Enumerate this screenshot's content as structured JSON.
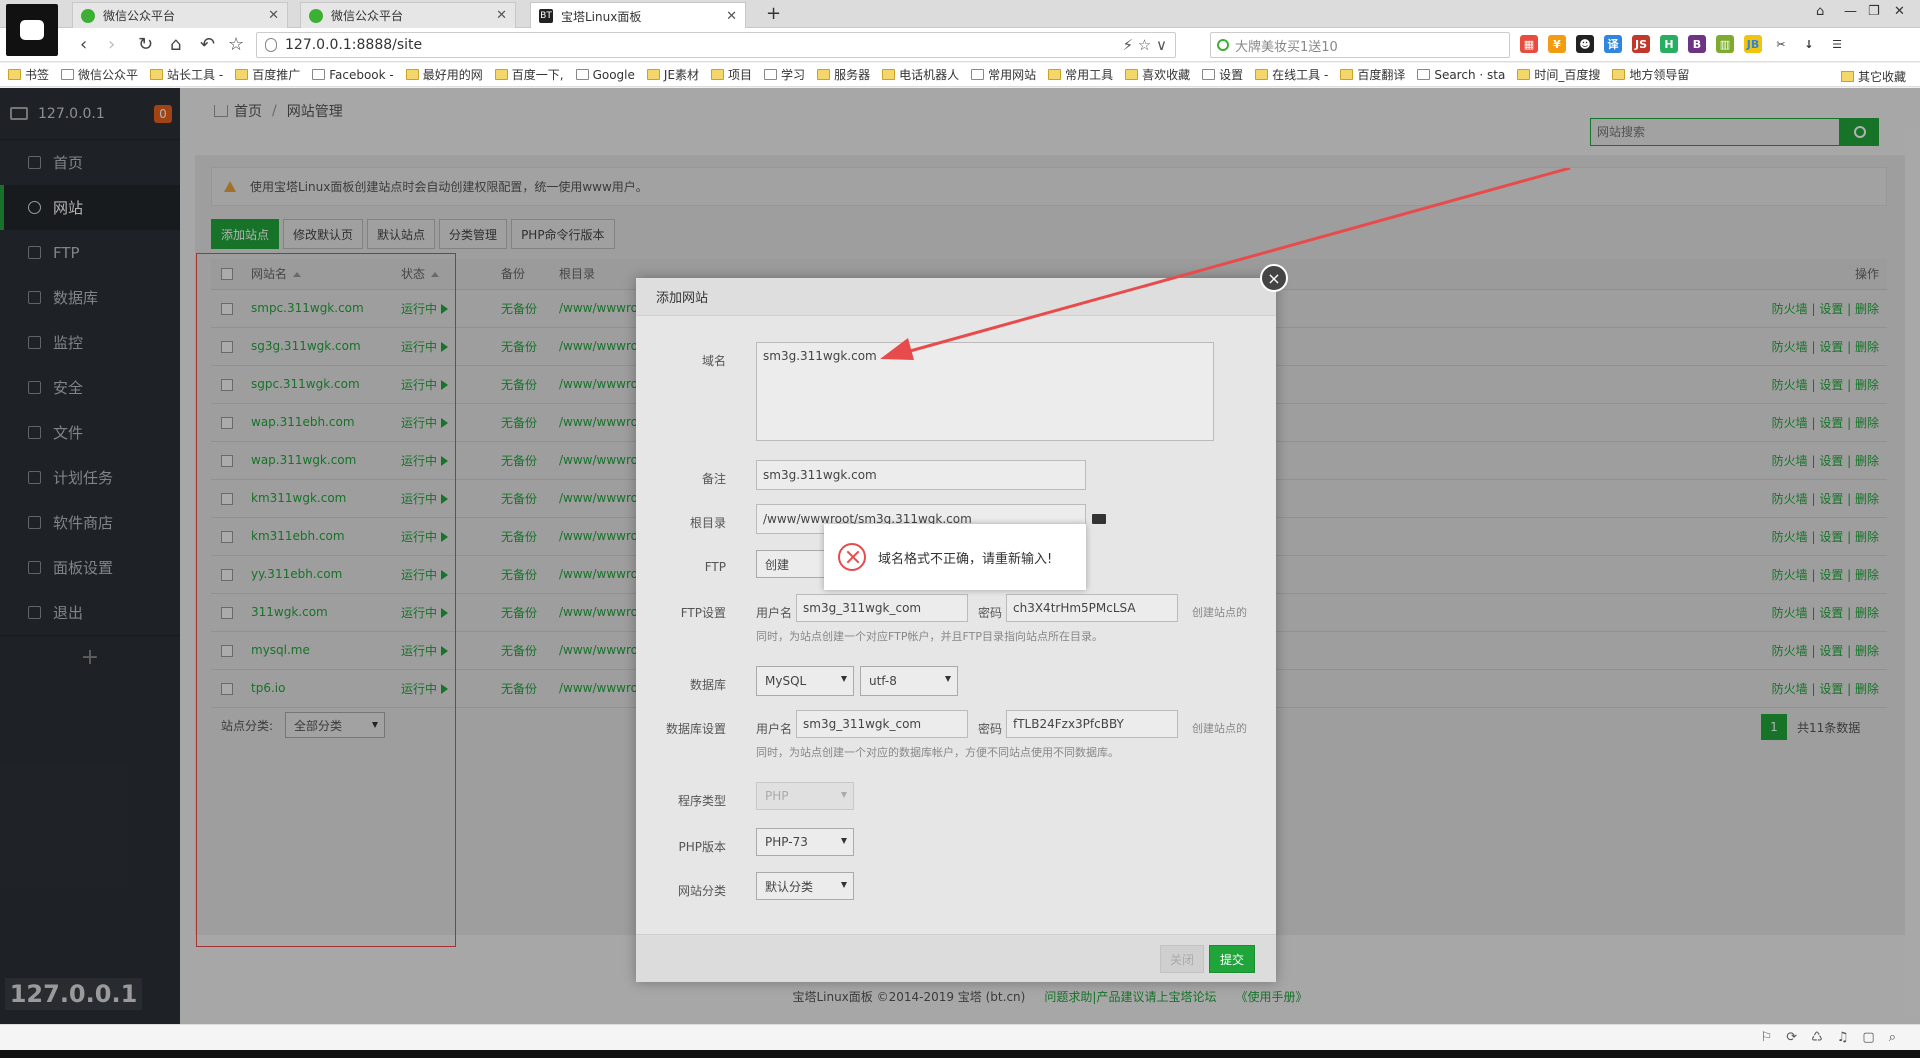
{
  "tabs": [
    {
      "label": "微信公众平台",
      "icon": "wechat-icon",
      "active": false
    },
    {
      "label": "微信公众平台",
      "icon": "wechat-icon",
      "active": false
    },
    {
      "label": "宝塔Linux面板",
      "icon": "bt-icon",
      "active": true
    }
  ],
  "address": {
    "url": "127.0.0.1:8888/site",
    "search_placeholder": "大牌美妆买1送10"
  },
  "bookmarks": [
    "书签",
    "微信公众平",
    "站长工具 -",
    "百度推广",
    "Facebook -",
    "最好用的网",
    "百度一下,",
    "Google",
    "JE素材",
    "项目",
    "学习",
    "服务器",
    "电话机器人",
    "常用网站",
    "常用工具",
    "喜欢收藏",
    "设置",
    "在线工具 -",
    "百度翻译",
    "Search · sta",
    "时间_百度搜",
    "地方领导留"
  ],
  "bookmarks_right": "其它收藏",
  "sidebar": {
    "host": "127.0.0.1",
    "badge": "0",
    "items": [
      "首页",
      "网站",
      "FTP",
      "数据库",
      "监控",
      "安全",
      "文件",
      "计划任务",
      "软件商店",
      "面板设置",
      "退出"
    ],
    "active": "网站",
    "add": "+",
    "ip_label": "127.0.0.1"
  },
  "breadcrumb": {
    "home": "首页",
    "sep": "/",
    "current": "网站管理"
  },
  "site_search": {
    "placeholder": "网站搜索"
  },
  "notice": "使用宝塔Linux面板创建站点时会自动创建权限配置，统一使用www用户。",
  "toolbar": [
    "添加站点",
    "修改默认页",
    "默认站点",
    "分类管理",
    "PHP命令行版本"
  ],
  "table": {
    "headers": {
      "name": "网站名",
      "status": "状态",
      "backup": "备份",
      "root": "根目录",
      "ops": "操作"
    },
    "rows": [
      {
        "name": "smpc.311wgk.com",
        "status": "运行中",
        "backup": "无备份",
        "root": "/www/wwwro"
      },
      {
        "name": "sg3g.311wgk.com",
        "status": "运行中",
        "backup": "无备份",
        "root": "/www/wwwro"
      },
      {
        "name": "sgpc.311wgk.com",
        "status": "运行中",
        "backup": "无备份",
        "root": "/www/wwwro"
      },
      {
        "name": "wap.311ebh.com",
        "status": "运行中",
        "backup": "无备份",
        "root": "/www/wwwro"
      },
      {
        "name": "wap.311wgk.com",
        "status": "运行中",
        "backup": "无备份",
        "root": "/www/wwwro"
      },
      {
        "name": "km311wgk.com",
        "status": "运行中",
        "backup": "无备份",
        "root": "/www/wwwro"
      },
      {
        "name": "km311ebh.com",
        "status": "运行中",
        "backup": "无备份",
        "root": "/www/wwwro"
      },
      {
        "name": "yy.311ebh.com",
        "status": "运行中",
        "backup": "无备份",
        "root": "/www/wwwro"
      },
      {
        "name": "311wgk.com",
        "status": "运行中",
        "backup": "无备份",
        "root": "/www/wwwro"
      },
      {
        "name": "mysql.me",
        "status": "运行中",
        "backup": "无备份",
        "root": "/www/wwwro"
      },
      {
        "name": "tp6.io",
        "status": "运行中",
        "backup": "无备份",
        "root": "/www/wwwro"
      }
    ],
    "ops_text": "防火墙 | 设置 | 删除"
  },
  "category": {
    "label": "站点分类:",
    "value": "全部分类"
  },
  "pager": {
    "page": "1",
    "total": "共11条数据"
  },
  "copyright": {
    "text": "宝塔Linux面板 ©2014-2019 宝塔 (bt.cn)",
    "link1": "问题求助|产品建议请上宝塔论坛",
    "link2": "《使用手册》"
  },
  "dialog": {
    "title": "添加网站",
    "close": "×",
    "domain_label": "域名",
    "domain_value": "sm3g.311wgk.com",
    "remark_label": "备注",
    "remark_value": "sm3g.311wgk.com",
    "root_label": "根目录",
    "root_value": "/www/wwwroot/sm3g.311wgk.com",
    "ftp_label": "FTP",
    "ftp_value": "创建",
    "ftp_settings_label": "FTP设置",
    "ftp_user_label": "用户名",
    "ftp_user": "sm3g_311wgk_com",
    "ftp_pass_label": "密码",
    "ftp_pass": "ch3X4trHm5PMcLSA",
    "ftp_hint_right": "创建站点的",
    "ftp_hint": "同时，为站点创建一个对应FTP帐户，并且FTP目录指向站点所在目录。",
    "db_label": "数据库",
    "db_type": "MySQL",
    "db_charset": "utf-8",
    "db_settings_label": "数据库设置",
    "db_user_label": "用户名",
    "db_user": "sm3g_311wgk_com",
    "db_pass_label": "密码",
    "db_pass": "fTLB24Fzx3PfcBBY",
    "db_hint_right": "创建站点的",
    "db_hint": "同时，为站点创建一个对应的数据库帐户，方便不同站点使用不同数据库。",
    "prog_label": "程序类型",
    "prog_value": "PHP",
    "php_label": "PHP版本",
    "php_value": "PHP-73",
    "cat_label": "网站分类",
    "cat_value": "默认分类",
    "btn_close": "关闭",
    "btn_submit": "提交"
  },
  "toast": {
    "message": "域名格式不正确，请重新输入!"
  },
  "colors": {
    "accent": "#20a53a",
    "sidebar": "#2c3138",
    "error": "#e84b4b",
    "annotation": "#e84b4b"
  }
}
